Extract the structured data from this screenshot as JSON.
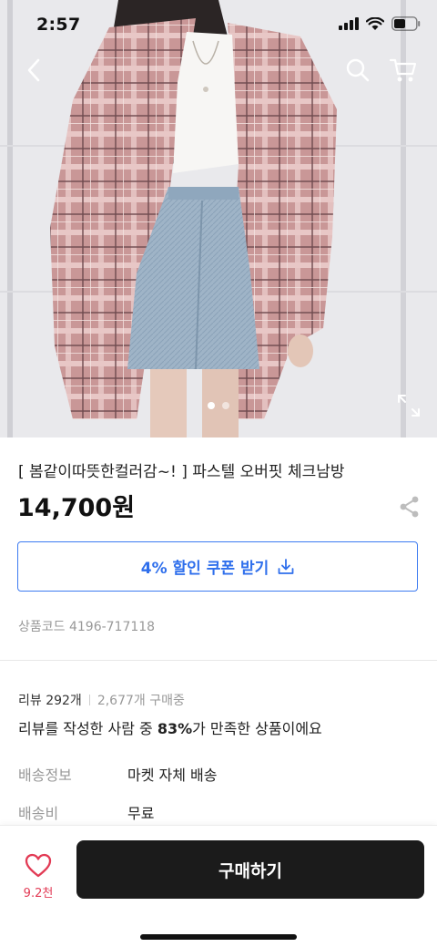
{
  "status_bar": {
    "time": "2:57"
  },
  "icons": {
    "back": "chevron-left-icon",
    "search": "search-icon",
    "cart": "cart-icon",
    "expand": "expand-icon",
    "share": "share-icon",
    "download": "download-icon",
    "heart": "heart-icon"
  },
  "carousel": {
    "total": 2,
    "active_index": 0
  },
  "product": {
    "title": "[ 봄같이따뜻한컬러감~! ] 파스텔 오버핏 체크남방",
    "price": "14,700원",
    "coupon_label": "4% 할인 쿠폰 받기",
    "product_code": "상품코드 4196-717118"
  },
  "reviews": {
    "count_label": "리뷰 292개",
    "buyers_label": "2,677개 구매중",
    "summary_prefix": "리뷰를 작성한 사람 중 ",
    "summary_percent": "83%",
    "summary_suffix": "가 만족한 상품이에요"
  },
  "info_rows": [
    {
      "label": "배송정보",
      "value": "마켓 자체 배송"
    },
    {
      "label": "배송비",
      "value": "무료"
    }
  ],
  "bottom_bar": {
    "like_count": "9.2천",
    "buy_label": "구매하기"
  },
  "colors": {
    "accent_blue": "#2f6fec",
    "like_red": "#e23b55",
    "buy_button": "#1b1b1b"
  }
}
